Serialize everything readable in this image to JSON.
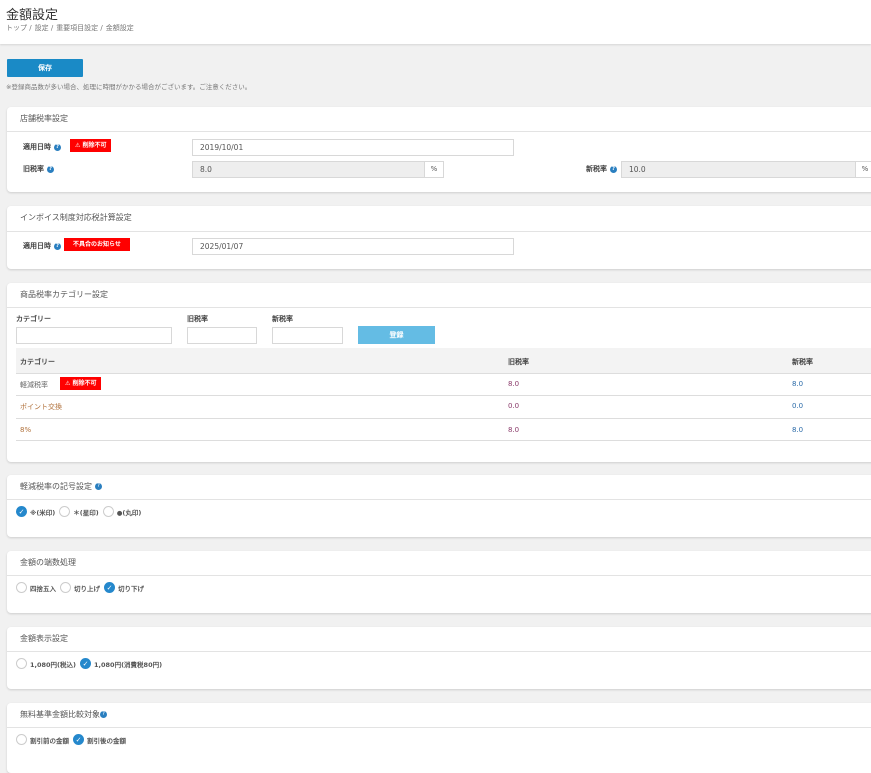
{
  "header": {
    "title": "金額設定",
    "breadcrumb": [
      "トップ /",
      "設定 /",
      "重要項目設定 /",
      "金額設定"
    ]
  },
  "save_label": "保存",
  "note": "※登録商品数が多い場合、処理に時間がかかる場合がございます。ご注意ください。",
  "store_tax": {
    "title": "店舗税率設定",
    "apply_date_label": "適用日時",
    "badge": "⚠ 削除不可",
    "apply_date": "2019/10/01",
    "old_rate_label": "旧税率",
    "old_rate": "8.0",
    "new_rate_label": "新税率",
    "new_rate": "10.0",
    "pct": "%"
  },
  "invoice": {
    "title": "インボイス制度対応税計算設定",
    "apply_date_label": "適用日時",
    "badge": "不具合のお知らせ",
    "apply_date": "2025/01/07"
  },
  "category": {
    "title": "商品税率カテゴリー設定",
    "category_label": "カテゴリー",
    "old_label": "旧税率",
    "new_label": "新税率",
    "register": "登録",
    "columns": [
      "カテゴリー",
      "旧税率",
      "新税率"
    ],
    "rows": [
      {
        "name": "軽減税率",
        "badge": "⚠ 削除不可",
        "old": "8.0",
        "new": "8.0"
      },
      {
        "name": "ポイント交換",
        "old": "0.0",
        "new": "0.0"
      },
      {
        "name": "8%",
        "old": "8.0",
        "new": "8.0"
      }
    ]
  },
  "symbol": {
    "title": "軽減税率の記号設定",
    "options": [
      "※(米印)",
      "＊(星印)",
      "●(丸印)"
    ],
    "selected": 0
  },
  "rounding": {
    "title": "金額の端数処理",
    "options": [
      "四捨五入",
      "切り上げ",
      "切り下げ"
    ],
    "selected": 2
  },
  "display": {
    "title": "金額表示設定",
    "options": [
      "1,080円(税込)",
      "1,080円(消費税80円)"
    ],
    "selected": 1
  },
  "free": {
    "title": "無料基準金額比較対象",
    "options": [
      "割引前の金額",
      "割引後の金額"
    ],
    "selected": 1
  }
}
